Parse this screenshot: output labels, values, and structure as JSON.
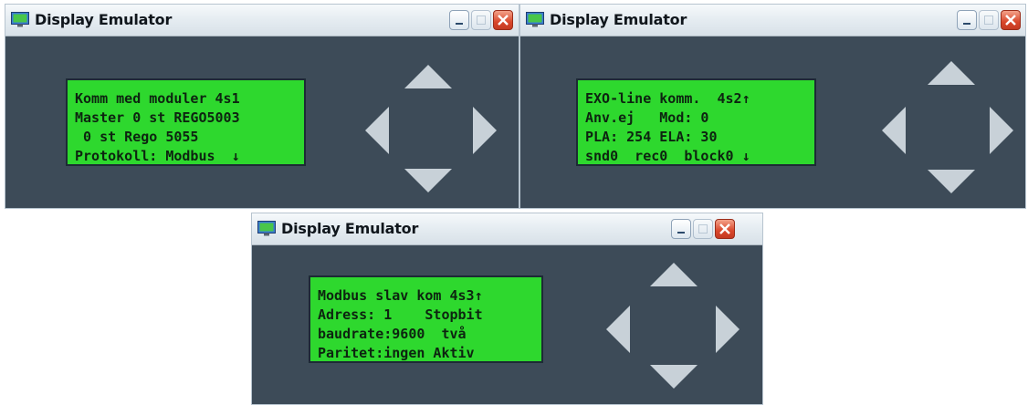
{
  "windows": [
    {
      "title": "Display Emulator",
      "lcd_lines": [
        "Komm med moduler 4s1",
        "Master 0 st REGO5003",
        " 0 st Rego 5055",
        "Protokoll: Modbus  ↓"
      ]
    },
    {
      "title": "Display Emulator",
      "lcd_lines": [
        "EXO-line komm.  4s2↑",
        "Anv.ej   Mod: 0",
        "PLA: 254 ELA: 30",
        "snd0  rec0  block0 ↓"
      ]
    },
    {
      "title": "Display Emulator",
      "lcd_lines": [
        "Modbus slav kom 4s3↑",
        "Adress: 1    Stopbit",
        "baudrate:9600  två",
        "Paritet:ingen Aktiv"
      ]
    }
  ],
  "colors": {
    "window_body": "#3d4b58",
    "lcd_background": "#2ed82e",
    "lcd_text": "#0d2410",
    "nav_arrow": "#c8d1d8",
    "close_button": "#d9472b"
  },
  "icons": {
    "app": "display-emulator-icon",
    "minimize": "minimize-icon",
    "maximize": "maximize-icon",
    "close": "close-icon",
    "nav": [
      "arrow-up-icon",
      "arrow-left-icon",
      "arrow-right-icon",
      "arrow-down-icon"
    ]
  }
}
